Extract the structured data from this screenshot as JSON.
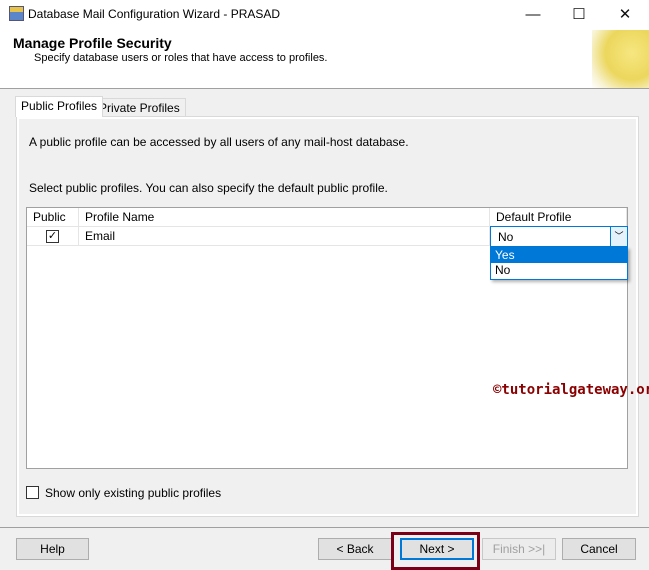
{
  "window": {
    "title": "Database Mail Configuration Wizard - PRASAD",
    "minimize": "—",
    "maximize": "☐",
    "close": "✕"
  },
  "header": {
    "title": "Manage Profile Security",
    "subtitle": "Specify database users or roles that have access to profiles."
  },
  "tabs": [
    {
      "label": "Public Profiles",
      "active": true
    },
    {
      "label": "Private Profiles",
      "active": false
    }
  ],
  "panel": {
    "description": "A public profile can be accessed by all users of any mail-host database.",
    "instruction": "Select public profiles. You can also specify the default public profile."
  },
  "grid": {
    "columns": [
      "Public",
      "Profile Name",
      "Default Profile"
    ],
    "rows": [
      {
        "public": true,
        "check": "✓",
        "name": "Email",
        "default": "No"
      }
    ],
    "dropdown_options": [
      "Yes",
      "No"
    ],
    "highlighted_option": "Yes"
  },
  "show_existing": {
    "label": "Show only existing public profiles",
    "checked": false
  },
  "watermark": "©tutorialgateway.org",
  "buttons": {
    "help": "Help",
    "back": "< Back",
    "next": "Next >",
    "finish": "Finish >>|",
    "cancel": "Cancel"
  },
  "colors": {
    "selection": "#0078d7",
    "highlight_box": "#7a0018",
    "watermark": "#8b0000"
  }
}
